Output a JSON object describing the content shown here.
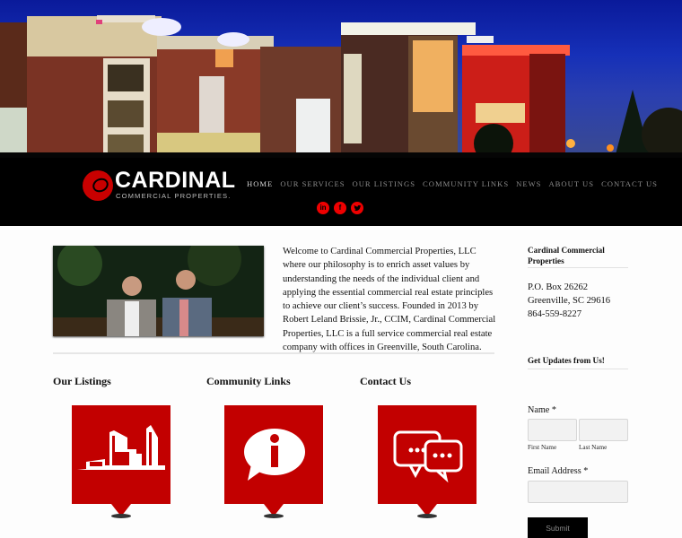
{
  "brand": {
    "name": "CARDINAL",
    "tagline": "COMMERCIAL PROPERTIES."
  },
  "nav": {
    "items": [
      {
        "label": "HOME",
        "active": true
      },
      {
        "label": "OUR SERVICES",
        "active": false
      },
      {
        "label": "OUR LISTINGS",
        "active": false
      },
      {
        "label": "COMMUNITY LINKS",
        "active": false
      },
      {
        "label": "NEWS",
        "active": false
      },
      {
        "label": "ABOUT US",
        "active": false
      },
      {
        "label": "CONTACT US",
        "active": false
      }
    ]
  },
  "social": {
    "linkedin": "in",
    "facebook": "f",
    "twitter": "t"
  },
  "intro": {
    "text": "Welcome to Cardinal Commercial Properties, LLC where our philosophy is to enrich asset values by understanding the needs of the individual client and applying the essential commercial real estate principles to achieve our client’s success. Founded in 2013 by Robert Leland Brissie, Jr., CCIM, Cardinal Commercial Properties, LLC is a full service commercial real estate company with offices in Greenville, South Carolina."
  },
  "sections": [
    {
      "title": "Our Listings",
      "icon": "building-icon"
    },
    {
      "title": "Community Links",
      "icon": "info-bubble-icon"
    },
    {
      "title": "Contact Us",
      "icon": "chat-bubbles-icon"
    }
  ],
  "sidebar": {
    "company_title": "Cardinal Commercial Properties",
    "address_line1": "P.O. Box 26262",
    "address_line2": "Greenville, SC 29616",
    "phone": "864-559-8227",
    "updates_title": "Get Updates from Us!",
    "form": {
      "name_label": "Name *",
      "first_name_label": "First Name",
      "last_name_label": "Last Name",
      "first_name_value": "",
      "last_name_value": "",
      "email_label": "Email Address *",
      "email_value": "",
      "submit_label": "Submit"
    }
  },
  "colors": {
    "brand_red": "#c20000",
    "header_bg": "#000000",
    "social_red": "#ee0000"
  }
}
